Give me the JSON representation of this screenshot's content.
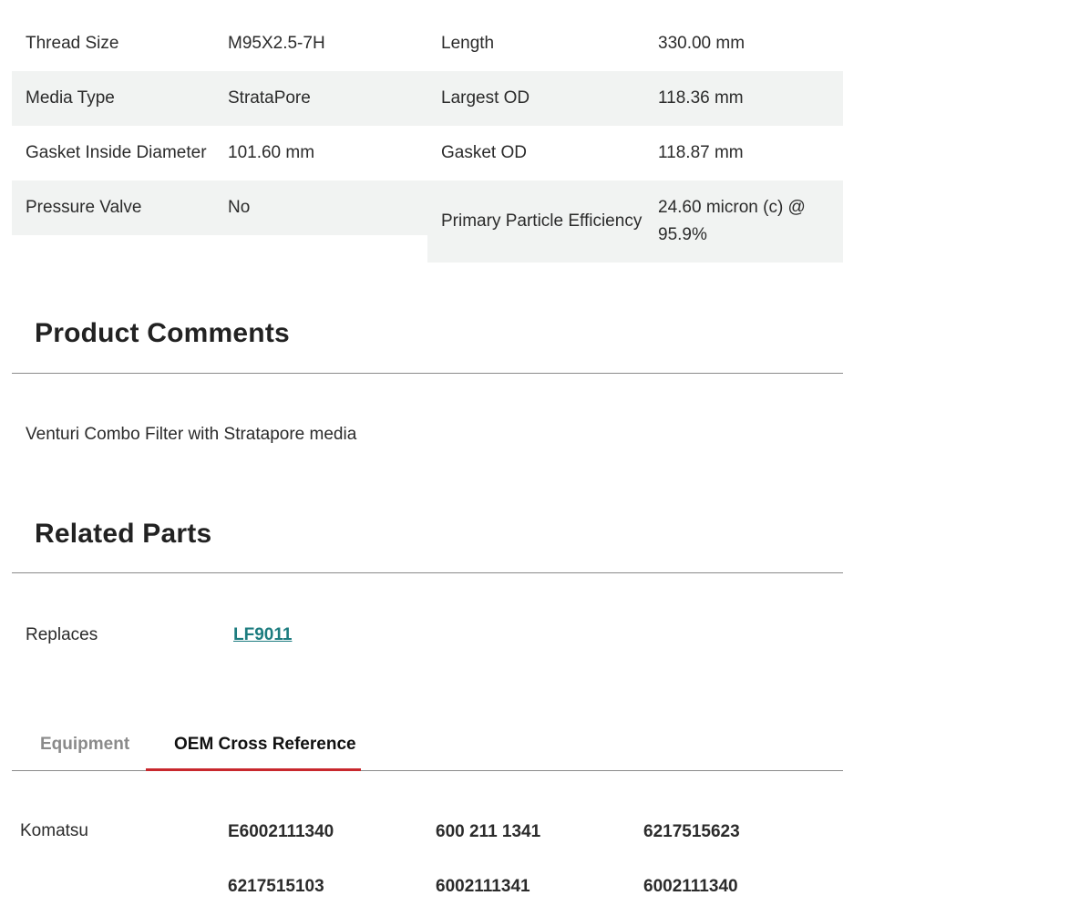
{
  "specs": [
    {
      "label_left": "Thread Size",
      "value_left": "M95X2.5-7H",
      "label_right": "Length",
      "value_right": "330.00 mm"
    },
    {
      "label_left": "Media Type",
      "value_left": "StrataPore",
      "label_right": "Largest OD",
      "value_right": "118.36 mm"
    },
    {
      "label_left": "Gasket Inside Diameter",
      "value_left": "101.60 mm",
      "label_right": "Gasket OD",
      "value_right": "118.87 mm"
    },
    {
      "label_left": "Pressure Valve",
      "value_left": "No",
      "label_right": "Primary Particle Efficiency",
      "value_right": "24.60 micron (c) @ 95.9%"
    }
  ],
  "product_comments": {
    "title": "Product Comments",
    "text": "Venturi Combo Filter with Stratapore media"
  },
  "related_parts": {
    "title": "Related Parts",
    "label": "Replaces",
    "link": "LF9011"
  },
  "tabs": [
    {
      "label": "Equipment",
      "active": false
    },
    {
      "label": "OEM Cross Reference",
      "active": true
    }
  ],
  "cross_reference": {
    "brand": "Komatsu",
    "parts": [
      "E6002111340",
      "600 211 1341",
      "6217515623",
      "6217515103",
      "6002111341",
      "6002111340"
    ]
  },
  "colors": {
    "accent": "#c8282d",
    "link": "#1c7c7f",
    "row_shade": "#f1f3f2"
  }
}
